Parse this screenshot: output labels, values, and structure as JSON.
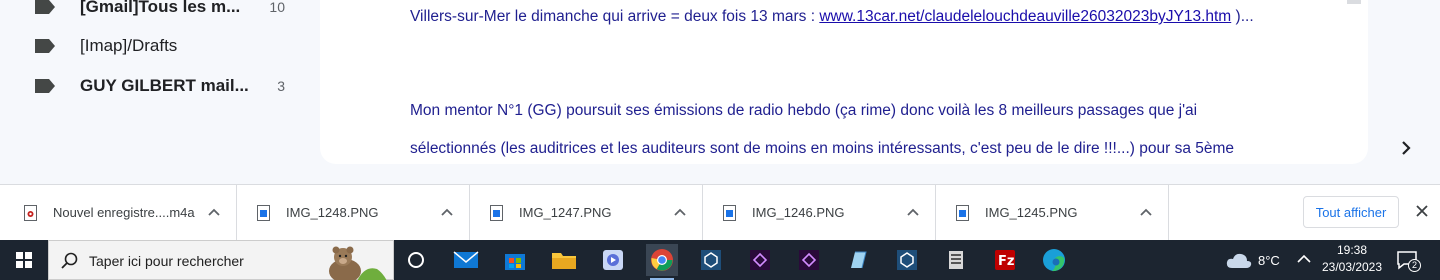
{
  "sidebar": {
    "labels": [
      {
        "name": "[Gmail]Tous les m...",
        "count": "10",
        "bold": true
      },
      {
        "name": "[Imap]/Drafts",
        "count": "",
        "bold": false
      },
      {
        "name": "GUY GILBERT mail...",
        "count": "3",
        "bold": true
      }
    ]
  },
  "mail": {
    "line1_prefix": "Villers-sur-Mer le dimanche qui arrive = deux fois 13 mars : ",
    "line1_link": "www.13car.net/claudelelouchdeauville26032023byJY13.htm",
    "line1_suffix": " )...",
    "line2": "Mon mentor N°1 (GG) poursuit ses émissions de radio hebdo (ça rime) donc voilà les 8 meilleurs passages que j'ai",
    "line3": "sélectionnés (les auditrices et les auditeurs sont de moins en moins intéressants, c'est peu de le dire !!!...) pour sa 5ème"
  },
  "downloads": {
    "items": [
      {
        "name": "Nouvel enregistre....m4a",
        "type": "audio"
      },
      {
        "name": "IMG_1248.PNG",
        "type": "image"
      },
      {
        "name": "IMG_1247.PNG",
        "type": "image"
      },
      {
        "name": "IMG_1246.PNG",
        "type": "image"
      },
      {
        "name": "IMG_1245.PNG",
        "type": "image"
      }
    ],
    "show_all_label": "Tout afficher"
  },
  "taskbar": {
    "search_placeholder": "Taper ici pour rechercher",
    "apps": [
      "task-view",
      "mail",
      "store",
      "file-explorer",
      "media-player",
      "chrome",
      "app-cube-1",
      "premiere-1",
      "premiere-2",
      "notes",
      "app-cube-2",
      "server",
      "filezilla",
      "edge"
    ],
    "weather": "8°C",
    "time": "19:38",
    "date": "23/03/2023",
    "notification_count": "2"
  },
  "colors": {
    "gmail_bg": "#f6f8fc",
    "mail_text": "#1f1f8f",
    "link": "#1a0dab",
    "taskbar": "#1c2530",
    "accent": "#1a73e8"
  }
}
